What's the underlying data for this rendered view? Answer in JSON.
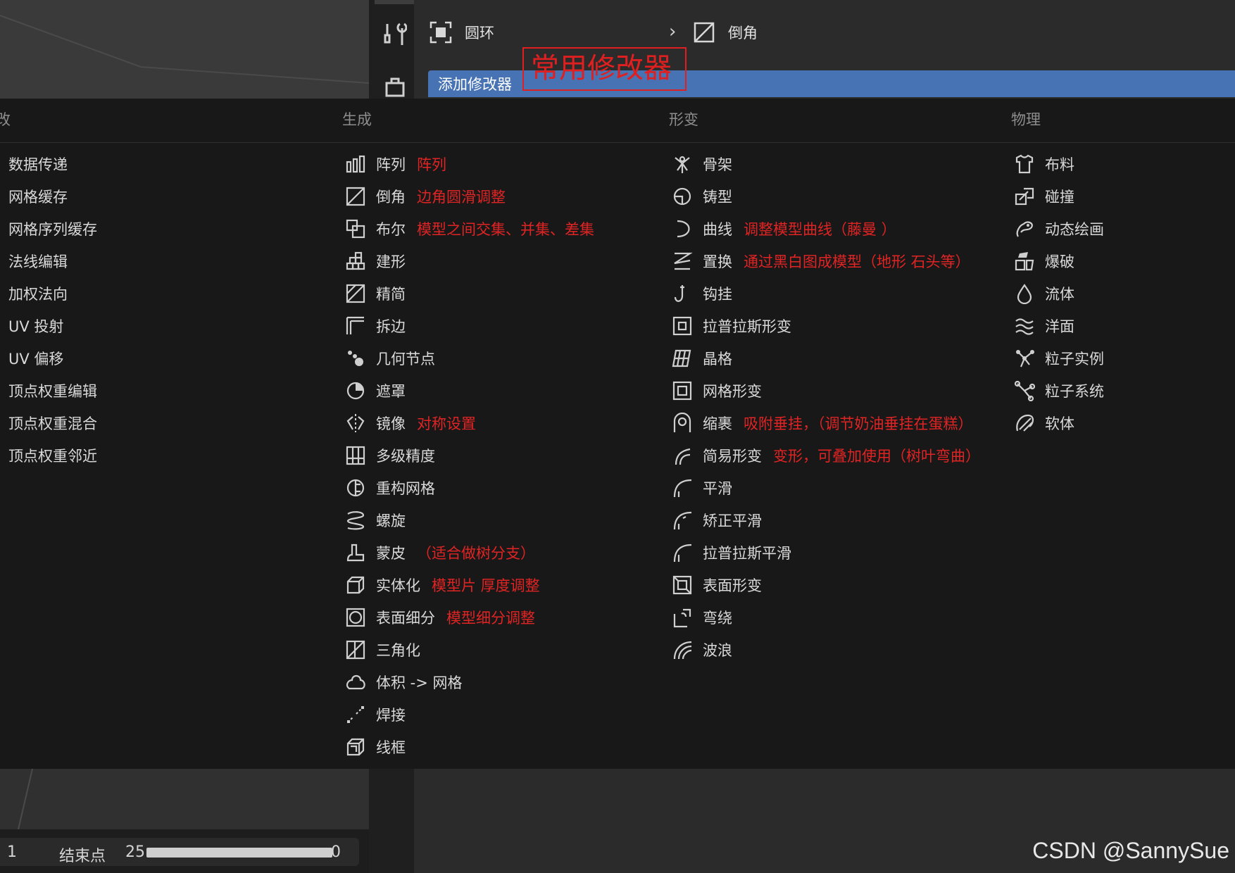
{
  "header": {
    "favorites": [
      {
        "label": "圆环",
        "icon": "square-target-icon"
      },
      {
        "label": "倒角",
        "icon": "bevel-icon"
      }
    ],
    "add_modifier_label": "添加修改器",
    "annotation_title": "常用修改器"
  },
  "menu": {
    "columns": [
      {
        "heading": "",
        "items": [
          {
            "label": "数据传递",
            "icon": "",
            "note": ""
          },
          {
            "label": "网格缓存",
            "icon": "",
            "note": ""
          },
          {
            "label": "网格序列缓存",
            "icon": "",
            "note": ""
          },
          {
            "label": "法线编辑",
            "icon": "",
            "note": ""
          },
          {
            "label": "加权法向",
            "icon": "",
            "note": ""
          },
          {
            "label": "UV 投射",
            "icon": "",
            "note": ""
          },
          {
            "label": "UV 偏移",
            "icon": "",
            "note": ""
          },
          {
            "label": "顶点权重编辑",
            "icon": "",
            "note": ""
          },
          {
            "label": "顶点权重混合",
            "icon": "",
            "note": ""
          },
          {
            "label": "顶点权重邻近",
            "icon": "",
            "note": ""
          }
        ]
      },
      {
        "heading": "生成",
        "items": [
          {
            "label": "阵列",
            "icon": "array-icon",
            "note": "阵列"
          },
          {
            "label": "倒角",
            "icon": "bevel-icon",
            "note": "边角圆滑调整"
          },
          {
            "label": "布尔",
            "icon": "boolean-icon",
            "note": "模型之间交集、并集、差集"
          },
          {
            "label": "建形",
            "icon": "build-icon",
            "note": ""
          },
          {
            "label": "精简",
            "icon": "decimate-icon",
            "note": ""
          },
          {
            "label": "拆边",
            "icon": "edge-split-icon",
            "note": ""
          },
          {
            "label": "几何节点",
            "icon": "geometry-nodes-icon",
            "note": ""
          },
          {
            "label": "遮罩",
            "icon": "mask-icon",
            "note": ""
          },
          {
            "label": "镜像",
            "icon": "mirror-icon",
            "note": "对称设置"
          },
          {
            "label": "多级精度",
            "icon": "multires-icon",
            "note": ""
          },
          {
            "label": "重构网格",
            "icon": "remesh-icon",
            "note": ""
          },
          {
            "label": "螺旋",
            "icon": "screw-icon",
            "note": ""
          },
          {
            "label": "蒙皮",
            "icon": "skin-icon",
            "note": "（适合做树分支）"
          },
          {
            "label": "实体化",
            "icon": "solidify-icon",
            "note": "模型片 厚度调整"
          },
          {
            "label": "表面细分",
            "icon": "subdivision-icon",
            "note": "模型细分调整"
          },
          {
            "label": "三角化",
            "icon": "triangulate-icon",
            "note": ""
          },
          {
            "label": "体积 -> 网格",
            "icon": "volume-icon",
            "note": ""
          },
          {
            "label": "焊接",
            "icon": "weld-icon",
            "note": ""
          },
          {
            "label": "线框",
            "icon": "wireframe-icon",
            "note": ""
          }
        ]
      },
      {
        "heading": "形变",
        "items": [
          {
            "label": "骨架",
            "icon": "armature-icon",
            "note": ""
          },
          {
            "label": "铸型",
            "icon": "cast-icon",
            "note": ""
          },
          {
            "label": "曲线",
            "icon": "curve-icon",
            "note": "调整模型曲线（藤曼 ）"
          },
          {
            "label": "置换",
            "icon": "displace-icon",
            "note": "通过黑白图成模型（地形 石头等）"
          },
          {
            "label": "钩挂",
            "icon": "hook-icon",
            "note": ""
          },
          {
            "label": "拉普拉斯形变",
            "icon": "laplacian-deform-icon",
            "note": ""
          },
          {
            "label": "晶格",
            "icon": "lattice-icon",
            "note": ""
          },
          {
            "label": "网格形变",
            "icon": "mesh-deform-icon",
            "note": ""
          },
          {
            "label": "缩裹",
            "icon": "shrinkwrap-icon",
            "note": "吸附垂挂，（调节奶油垂挂在蛋糕）"
          },
          {
            "label": "简易形变",
            "icon": "simple-deform-icon",
            "note": "变形，可叠加使用（树叶弯曲）"
          },
          {
            "label": "平滑",
            "icon": "smooth-icon",
            "note": ""
          },
          {
            "label": "矫正平滑",
            "icon": "smooth-corrective-icon",
            "note": ""
          },
          {
            "label": "拉普拉斯平滑",
            "icon": "smooth-laplacian-icon",
            "note": ""
          },
          {
            "label": "表面形变",
            "icon": "surface-deform-icon",
            "note": ""
          },
          {
            "label": "弯绕",
            "icon": "warp-icon",
            "note": ""
          },
          {
            "label": "波浪",
            "icon": "wave-icon",
            "note": ""
          }
        ]
      },
      {
        "heading": "物理",
        "items": [
          {
            "label": "布料",
            "icon": "cloth-icon",
            "note": ""
          },
          {
            "label": "碰撞",
            "icon": "collision-icon",
            "note": ""
          },
          {
            "label": "动态绘画",
            "icon": "dynamic-paint-icon",
            "note": ""
          },
          {
            "label": "爆破",
            "icon": "explode-icon",
            "note": ""
          },
          {
            "label": "流体",
            "icon": "fluid-icon",
            "note": ""
          },
          {
            "label": "洋面",
            "icon": "ocean-icon",
            "note": ""
          },
          {
            "label": "粒子实例",
            "icon": "particle-instance-icon",
            "note": ""
          },
          {
            "label": "粒子系统",
            "icon": "particle-system-icon",
            "note": ""
          },
          {
            "label": "软体",
            "icon": "soft-body-icon",
            "note": ""
          }
        ]
      }
    ]
  },
  "timeline": {
    "current_frame": "1",
    "end_label": "结束点",
    "end_value": "25",
    "right_value": "0"
  },
  "watermark": "CSDN @SannySue",
  "colors": {
    "accent": "#4772b3",
    "annotation": "#e02020",
    "menu_bg": "#181818"
  }
}
